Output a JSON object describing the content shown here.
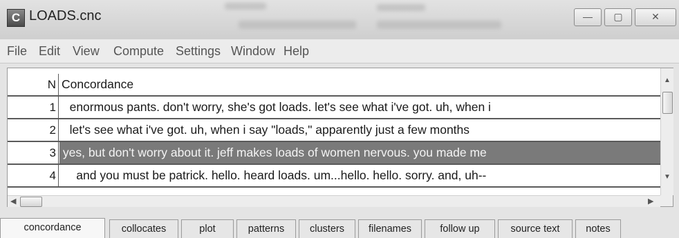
{
  "window": {
    "icon_letter": "C",
    "title": "LOADS.cnc",
    "minimize_glyph": "—",
    "maximize_glyph": "▢",
    "close_glyph": "✕"
  },
  "menu": {
    "items": [
      "File",
      "Edit",
      "View",
      "Compute",
      "Settings",
      "Window",
      "Help"
    ]
  },
  "grid": {
    "columns": {
      "n": "N",
      "concordance": "Concordance"
    },
    "rows": [
      {
        "n": "1",
        "text": "   enormous pants. don't worry, she's got loads. let's see what i've got. uh, when i"
      },
      {
        "n": "2",
        "text": "   let's see what i've got. uh, when i say \"loads,\" apparently just a few months"
      },
      {
        "n": "3",
        "text": " yes, but don't worry about it. jeff makes loads of women nervous. you made me",
        "selected": true
      },
      {
        "n": "4",
        "text": "     and you must be patrick. hello. heard loads. um...hello. hello. sorry. and, uh--"
      }
    ],
    "selected_row": 3
  },
  "scrollbars": {
    "up_arrow": "▲",
    "down_arrow": "▼",
    "left_arrow": "◀",
    "right_arrow": "▶"
  },
  "tabs": {
    "items": [
      "concordance",
      "collocates",
      "plot",
      "patterns",
      "clusters",
      "filenames",
      "follow up",
      "source text",
      "notes"
    ],
    "active": "concordance"
  }
}
